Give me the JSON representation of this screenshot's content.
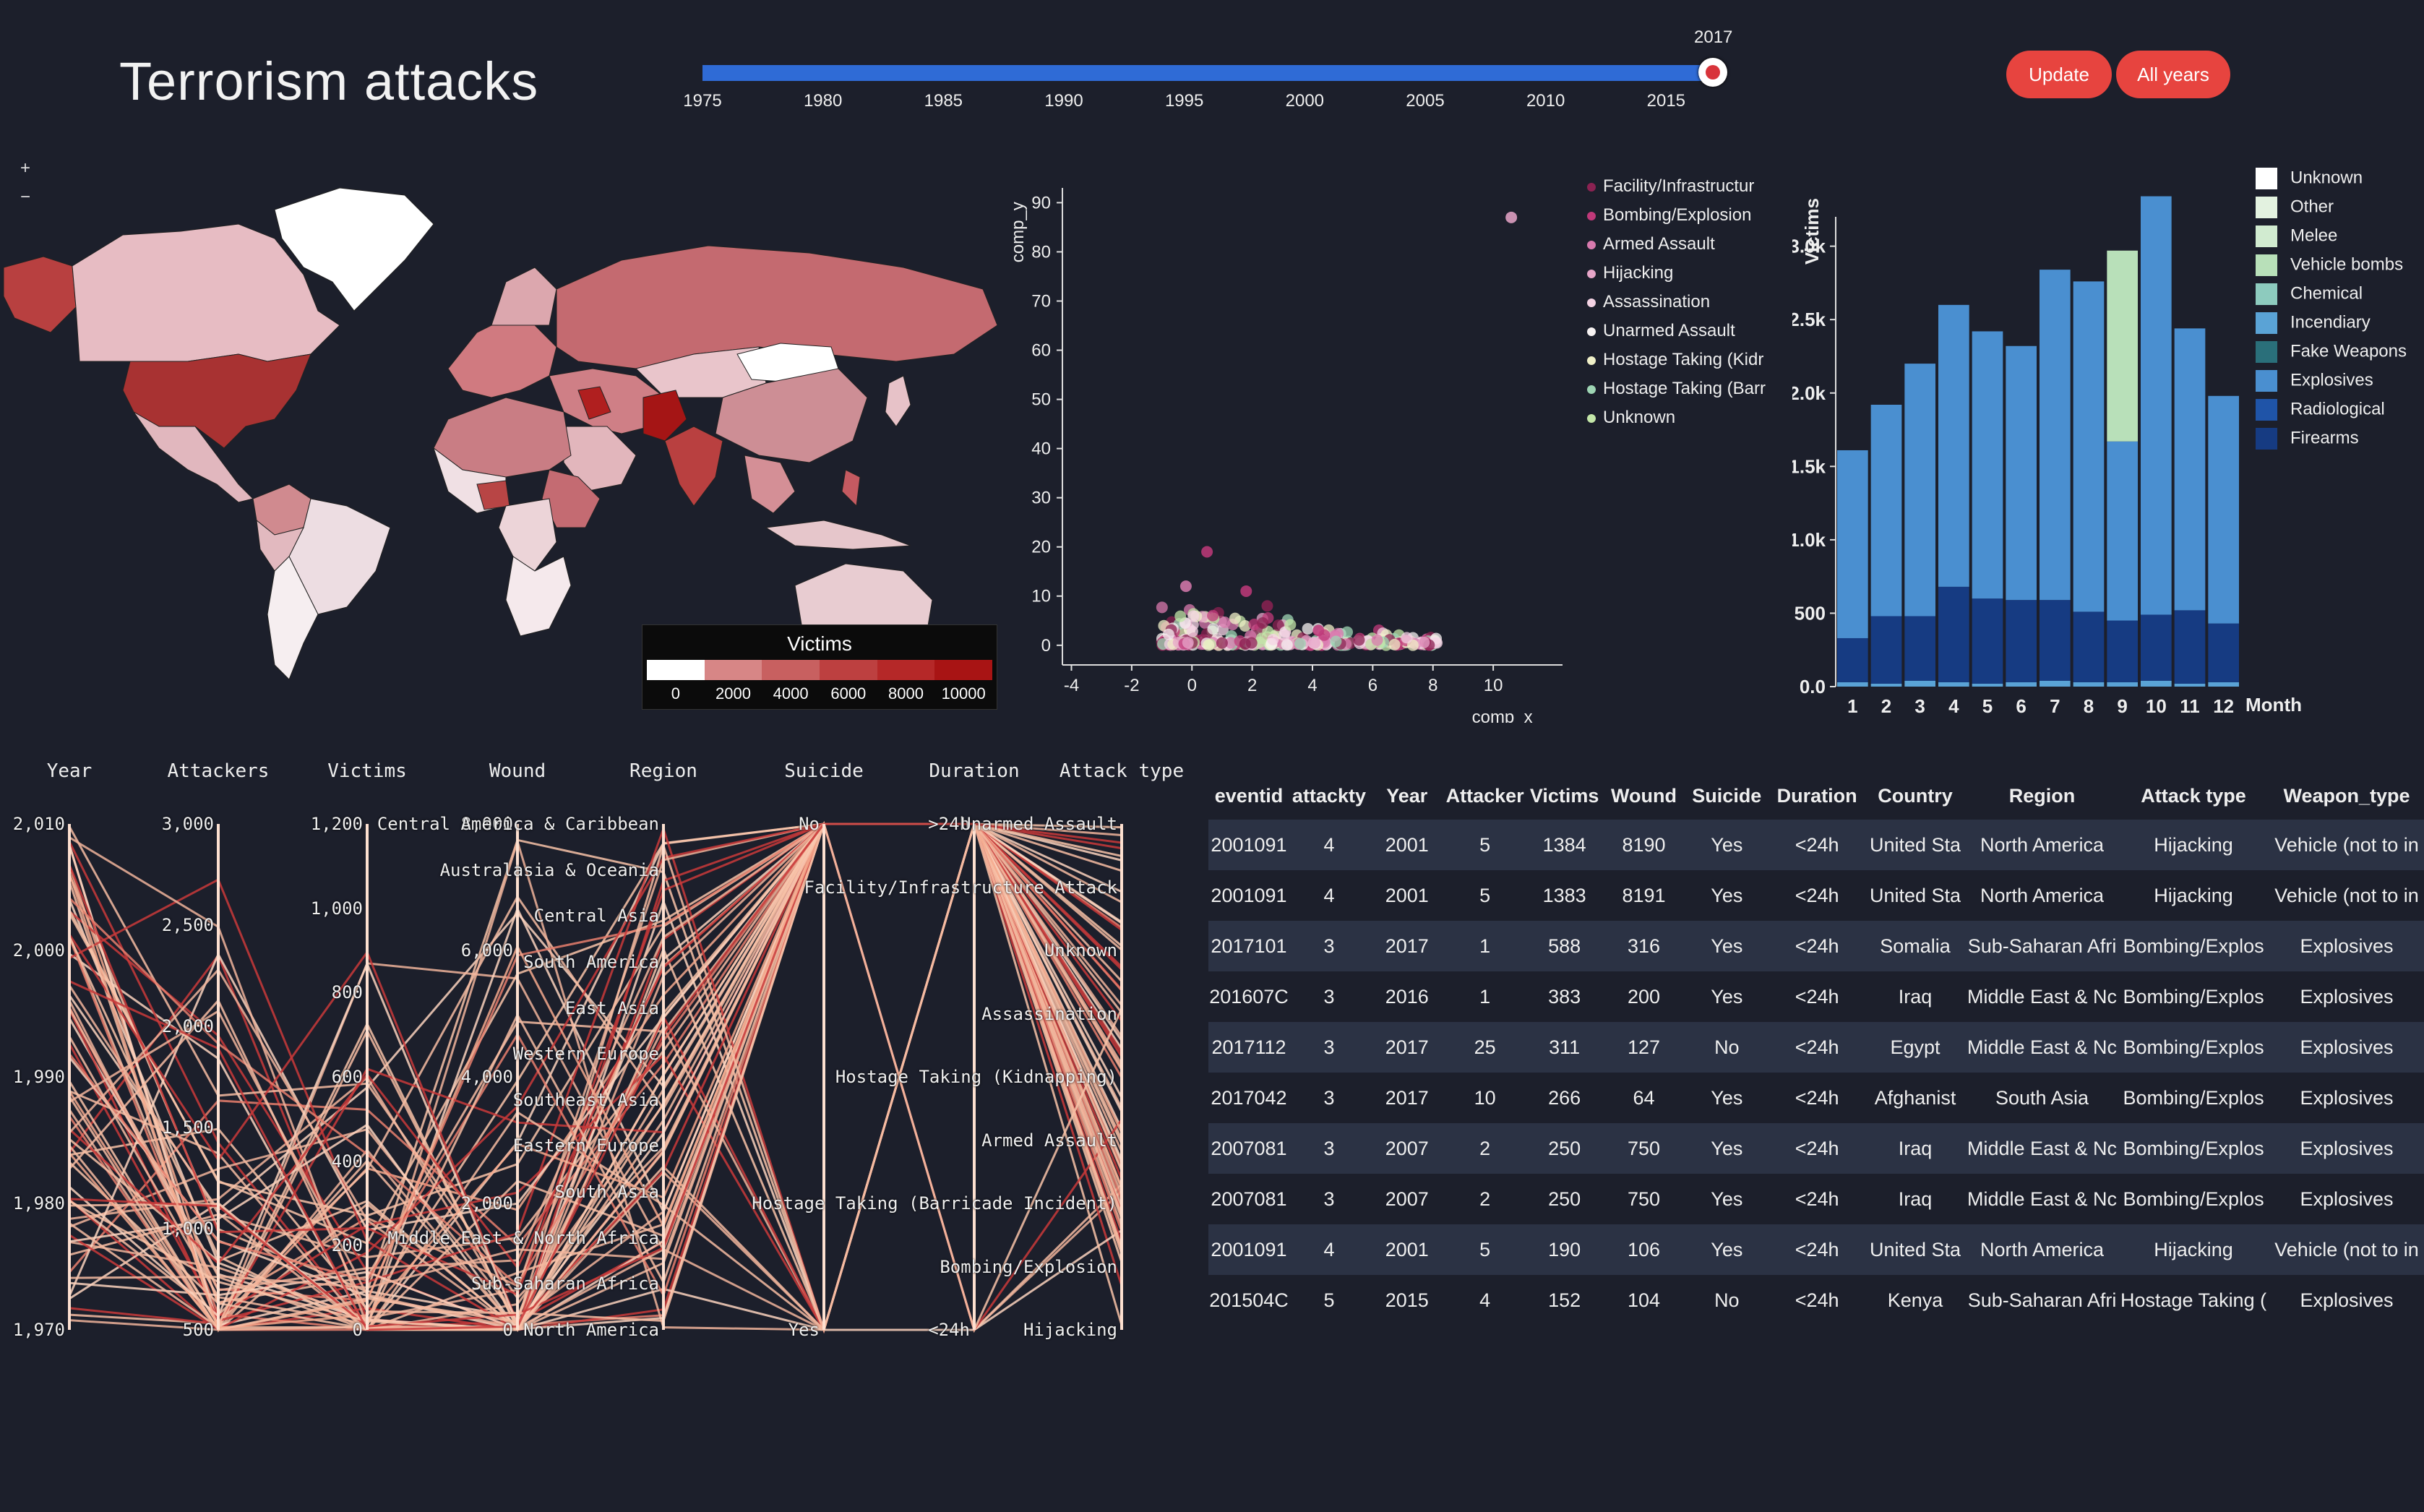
{
  "header": {
    "title": "Terrorism attacks",
    "update_label": "Update",
    "all_years_label": "All years"
  },
  "slider": {
    "value": 2017,
    "min": 1975,
    "max": 2017,
    "ticks": [
      "1975",
      "1980",
      "1985",
      "1990",
      "1995",
      "2000",
      "2005",
      "2010",
      "2015"
    ],
    "track_color": "#2f6bd6",
    "handle_color": "#d8343b"
  },
  "map": {
    "zoom_in": "+",
    "zoom_out": "−",
    "legend_title": "Victims",
    "legend_ticks": [
      "0",
      "2000",
      "4000",
      "6000",
      "8000",
      "10000"
    ],
    "legend_colors": [
      "#ffffff",
      "#d78686",
      "#c86060",
      "#bd4040",
      "#b52828",
      "#a81414"
    ]
  },
  "scatter": {
    "xlabel": "comp_x",
    "ylabel": "comp_y",
    "xticks": [
      "-4",
      "-2",
      "0",
      "2",
      "4",
      "6",
      "8",
      "10"
    ],
    "yticks": [
      "0",
      "10",
      "20",
      "30",
      "40",
      "50",
      "60",
      "70",
      "80",
      "90"
    ],
    "legend": [
      {
        "label": "Facility/Infrastructur",
        "color": "#8b2252"
      },
      {
        "label": "Bombing/Explosion",
        "color": "#c0397a"
      },
      {
        "label": "Armed Assault",
        "color": "#d87aae"
      },
      {
        "label": "Hijacking",
        "color": "#e7a6c9"
      },
      {
        "label": "Assassination",
        "color": "#f4d3e4"
      },
      {
        "label": "Unarmed Assault",
        "color": "#f6f2f2"
      },
      {
        "label": "Hostage Taking (Kidr",
        "color": "#f0f0c8"
      },
      {
        "label": "Hostage Taking (Barr",
        "color": "#9ed5b4"
      },
      {
        "label": "Unknown",
        "color": "#c3e6a8"
      }
    ]
  },
  "chart_data": {
    "type": "bar",
    "ylabel": "Victims",
    "xlabel": "Month",
    "categories": [
      "1",
      "2",
      "3",
      "4",
      "5",
      "6",
      "7",
      "8",
      "9",
      "10",
      "11",
      "12"
    ],
    "yticks": [
      "0.0",
      "500",
      "1.0k",
      "1.5k",
      "2.0k",
      "2.5k",
      "3.0k"
    ],
    "ylim": [
      0,
      3200
    ],
    "series": [
      {
        "name": "Firearms",
        "color": "#163b82",
        "values": [
          300,
          460,
          440,
          650,
          580,
          560,
          550,
          480,
          420,
          450,
          500,
          400
        ]
      },
      {
        "name": "Explosives",
        "color": "#4a8fd0",
        "values": [
          1280,
          1440,
          1720,
          1920,
          1820,
          1730,
          2250,
          2250,
          1220,
          2850,
          1920,
          1550
        ]
      },
      {
        "name": "Vehicle bombs",
        "color": "#b8e0b9",
        "values": [
          0,
          0,
          0,
          0,
          0,
          0,
          0,
          0,
          1300,
          0,
          0,
          0
        ]
      },
      {
        "name": "Incendiary",
        "color": "#5aa3d6",
        "values": [
          30,
          20,
          40,
          30,
          20,
          30,
          40,
          30,
          30,
          40,
          20,
          30
        ]
      }
    ],
    "legend": [
      {
        "label": "Unknown",
        "color": "#ffffff"
      },
      {
        "label": "Other",
        "color": "#e3f2e0"
      },
      {
        "label": "Melee",
        "color": "#d1ebd0"
      },
      {
        "label": "Vehicle bombs",
        "color": "#b8e0b9"
      },
      {
        "label": "Chemical",
        "color": "#8dcbbe"
      },
      {
        "label": "Incendiary",
        "color": "#5aa3d6"
      },
      {
        "label": "Fake Weapons",
        "color": "#2a6f7a"
      },
      {
        "label": "Explosives",
        "color": "#4a8fd0"
      },
      {
        "label": "Radiological",
        "color": "#1f54a8"
      },
      {
        "label": "Firearms",
        "color": "#163b82"
      }
    ]
  },
  "parcoords": {
    "headers": [
      "Year",
      "Attackers",
      "Victims",
      "Wound",
      "Region",
      "Suicide",
      "Duration",
      "Attack type"
    ],
    "year_ticks": [
      "2,010",
      "2,000",
      "1,990",
      "1,980",
      "1,970"
    ],
    "attackers_ticks": [
      "3,000",
      "2,500",
      "2,000",
      "1,500",
      "1,000",
      "500"
    ],
    "victims_ticks": [
      "1,200",
      "1,000",
      "800",
      "600",
      "400",
      "200",
      "0"
    ],
    "wound_ticks": [
      "8,000",
      "6,000",
      "4,000",
      "2,000",
      "0"
    ],
    "region_ticks": [
      "Central America & Caribbean",
      "Australasia & Oceania",
      "Central Asia",
      "South America",
      "East Asia",
      "Western Europe",
      "Southeast Asia",
      "Eastern Europe",
      "South Asia",
      "Middle East & North Africa",
      "Sub-Saharan Africa",
      "North America"
    ],
    "suicide_ticks": [
      "No",
      "Yes"
    ],
    "duration_ticks": [
      ">24h",
      "<24h"
    ],
    "attack_ticks": [
      "Unarmed Assault",
      "Facility/Infrastructure Attack",
      "Unknown",
      "Assassination",
      "Hostage Taking (Kidnapping)",
      "Armed Assault",
      "Hostage Taking (Barricade Incident)",
      "Bombing/Explosion",
      "Hijacking"
    ]
  },
  "table": {
    "columns": [
      "eventid",
      "attackty",
      "Year",
      "Attacker",
      "Victims",
      "Wound",
      "Suicide",
      "Duration",
      "Country",
      "Region",
      "Attack type",
      "Weapon_type"
    ],
    "rows": [
      [
        "2001091",
        "4",
        "2001",
        "5",
        "1384",
        "8190",
        "Yes",
        "<24h",
        "United Sta",
        "North America",
        "Hijacking",
        "Vehicle (not to in"
      ],
      [
        "2001091",
        "4",
        "2001",
        "5",
        "1383",
        "8191",
        "Yes",
        "<24h",
        "United Sta",
        "North America",
        "Hijacking",
        "Vehicle (not to in"
      ],
      [
        "2017101",
        "3",
        "2017",
        "1",
        "588",
        "316",
        "Yes",
        "<24h",
        "Somalia",
        "Sub-Saharan Afri",
        "Bombing/Explos",
        "Explosives"
      ],
      [
        "201607C",
        "3",
        "2016",
        "1",
        "383",
        "200",
        "Yes",
        "<24h",
        "Iraq",
        "Middle East & Nc",
        "Bombing/Explos",
        "Explosives"
      ],
      [
        "2017112",
        "3",
        "2017",
        "25",
        "311",
        "127",
        "No",
        "<24h",
        "Egypt",
        "Middle East & Nc",
        "Bombing/Explos",
        "Explosives"
      ],
      [
        "2017042",
        "3",
        "2017",
        "10",
        "266",
        "64",
        "Yes",
        "<24h",
        "Afghanist",
        "South Asia",
        "Bombing/Explos",
        "Explosives"
      ],
      [
        "2007081",
        "3",
        "2007",
        "2",
        "250",
        "750",
        "Yes",
        "<24h",
        "Iraq",
        "Middle East & Nc",
        "Bombing/Explos",
        "Explosives"
      ],
      [
        "2007081",
        "3",
        "2007",
        "2",
        "250",
        "750",
        "Yes",
        "<24h",
        "Iraq",
        "Middle East & Nc",
        "Bombing/Explos",
        "Explosives"
      ],
      [
        "2001091",
        "4",
        "2001",
        "5",
        "190",
        "106",
        "Yes",
        "<24h",
        "United Sta",
        "North America",
        "Hijacking",
        "Vehicle (not to in"
      ],
      [
        "201504C",
        "5",
        "2015",
        "4",
        "152",
        "104",
        "No",
        "<24h",
        "Kenya",
        "Sub-Saharan Afri",
        "Hostage Taking (",
        "Explosives"
      ]
    ]
  }
}
